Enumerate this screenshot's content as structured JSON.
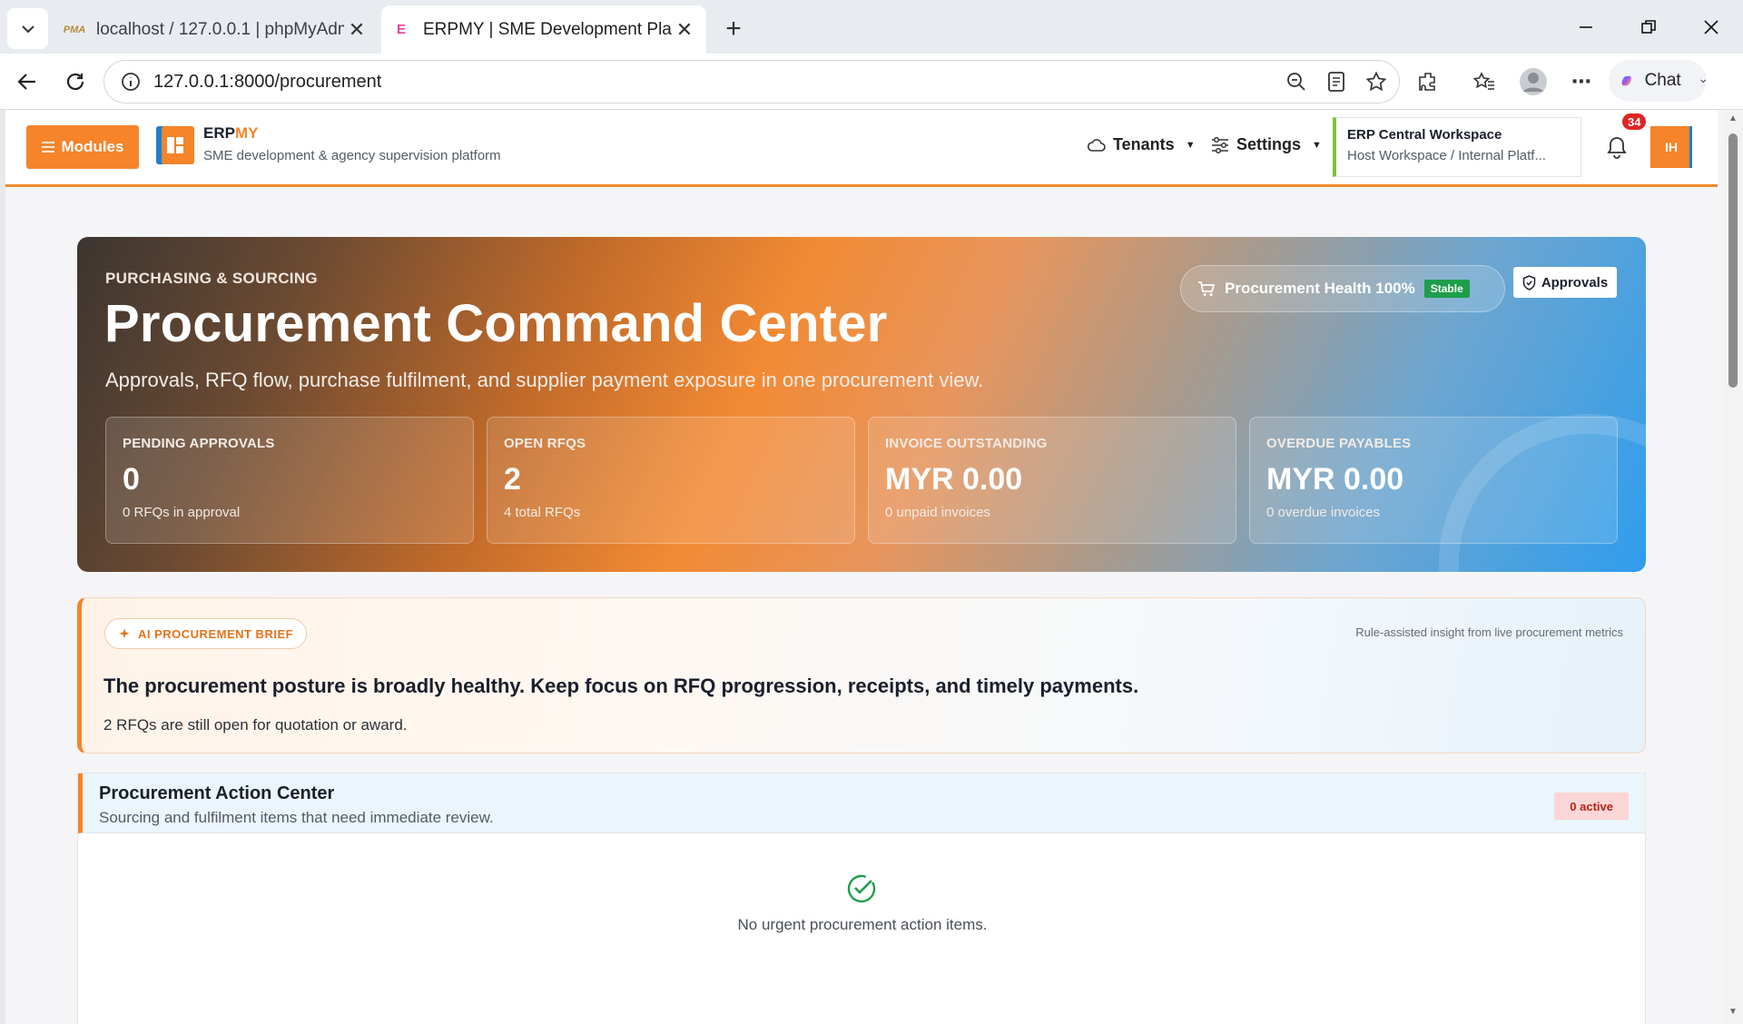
{
  "browser": {
    "tabs": [
      {
        "title": "localhost / 127.0.0.1 | phpMyAdmin",
        "active": false
      },
      {
        "title": "ERPMY | SME Development Platform",
        "active": true
      }
    ],
    "url": "127.0.0.1:8000/procurement",
    "chat_label": "Chat"
  },
  "header": {
    "modules_label": "Modules",
    "brand_prefix": "ERP",
    "brand_suffix": "MY",
    "brand_tagline": "SME development & agency supervision platform",
    "tenants_label": "Tenants",
    "settings_label": "Settings",
    "workspace_name": "ERP Central Workspace",
    "workspace_sub": "Host Workspace / Internal Platf...",
    "notification_count": "34",
    "avatar_initials": "IH"
  },
  "hero": {
    "eyebrow": "PURCHASING & SOURCING",
    "title": "Procurement Command Center",
    "lede": "Approvals, RFQ flow, purchase fulfilment, and supplier payment exposure in one procurement view.",
    "health_label": "Procurement Health 100%",
    "health_status": "Stable",
    "approvals_label": "Approvals",
    "kpis": [
      {
        "label": "PENDING APPROVALS",
        "value": "0",
        "note": "0 RFQs in approval"
      },
      {
        "label": "OPEN RFQS",
        "value": "2",
        "note": "4 total RFQs"
      },
      {
        "label": "INVOICE OUTSTANDING",
        "value": "MYR 0.00",
        "note": "0 unpaid invoices"
      },
      {
        "label": "OVERDUE PAYABLES",
        "value": "MYR 0.00",
        "note": "0 overdue invoices"
      }
    ]
  },
  "brief": {
    "pill": "AI PROCUREMENT BRIEF",
    "meta": "Rule-assisted insight from live procurement metrics",
    "headline": "The procurement posture is broadly healthy. Keep focus on RFQ progression, receipts, and timely payments.",
    "detail": "2 RFQs are still open for quotation or award."
  },
  "action_center": {
    "title": "Procurement Action Center",
    "subtitle": "Sourcing and fulfilment items that need immediate review.",
    "count_badge": "0 active",
    "empty_message": "No urgent procurement action items."
  },
  "colors": {
    "accent": "#f5842a",
    "secondary": "#1f7fd1",
    "success": "#1e9e4a",
    "danger": "#e02424"
  }
}
